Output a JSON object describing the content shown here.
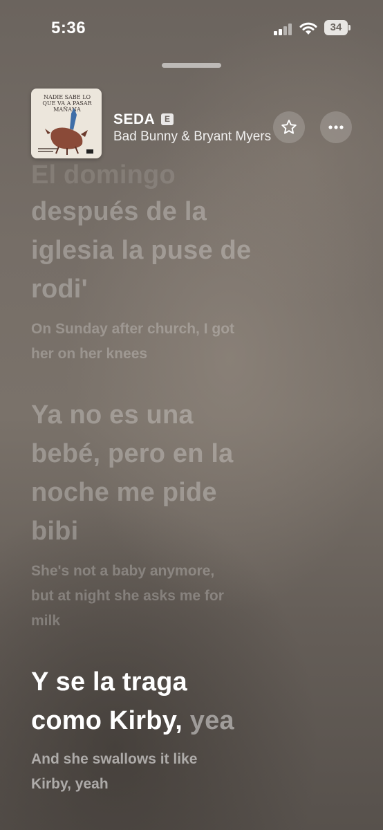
{
  "status_bar": {
    "time": "5:36",
    "battery": "34"
  },
  "now_playing": {
    "title": "SEDA",
    "explicit_badge": "E",
    "artist": "Bad Bunny & Bryant Myers",
    "album_art_text": "Nadie sabe lo que va a pasar mañana"
  },
  "lyrics": [
    {
      "lines": [
        "El domingo",
        "después de la",
        "iglesia la puse de",
        "rodi'"
      ],
      "translation": [
        "On Sunday after church, I got",
        "her on her knees"
      ]
    },
    {
      "lines": [
        "Ya no es una",
        "bebé, pero en la",
        "noche me pide",
        "bibi"
      ],
      "translation": [
        "She's not a baby anymore,",
        "but at night she asks me for",
        "milk"
      ]
    },
    {
      "active_lines": [
        "Y se la traga",
        "como Kirby,"
      ],
      "active_rest": "yea",
      "translation": [
        "And she swallows it like",
        "Kirby, yeah"
      ]
    }
  ],
  "icons": {
    "star": "star-icon",
    "more": "ellipsis-icon"
  }
}
